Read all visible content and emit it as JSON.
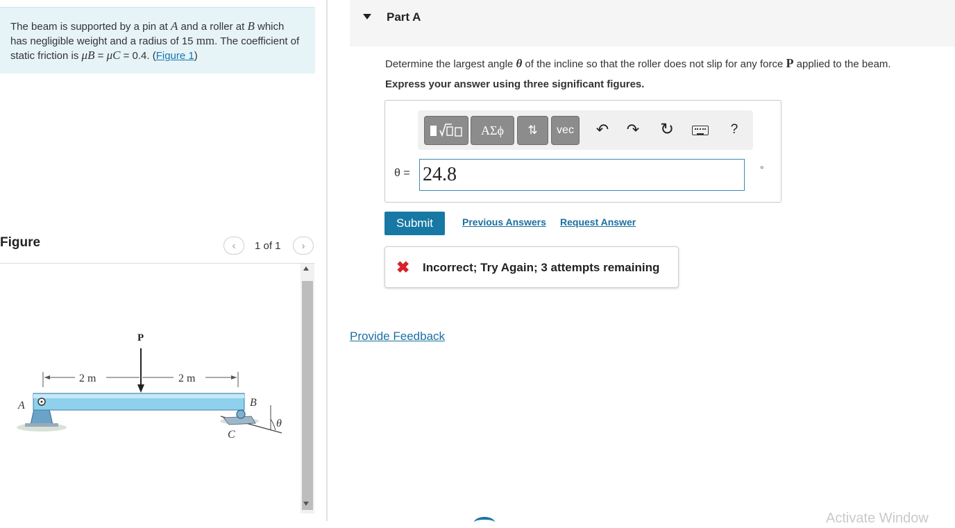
{
  "problem": {
    "text_1": "The beam is supported by a pin at ",
    "point_a": "A",
    "text_2": " and a roller at ",
    "point_b": "B",
    "text_3": " which has negligible weight and a radius of 15 ",
    "unit_mm": "mm",
    "text_4": ". The coefficient of static friction is ",
    "mu_b": "μB",
    "text_5": " = ",
    "mu_c": "μC",
    "text_6": " = 0.4. (",
    "figure_link": "Figure 1",
    "text_7": ")"
  },
  "figure": {
    "label": "Figure",
    "counter": "1 of 1",
    "prev_icon": "chevron-left",
    "next_icon": "chevron-right",
    "labels": {
      "p": "P",
      "a": "A",
      "b": "B",
      "c": "C",
      "theta": "θ",
      "dim_left": "2 m",
      "dim_right": "2 m"
    }
  },
  "part": {
    "toggle_icon": "caret-down",
    "title": "Part A",
    "question_1": "Determine the largest angle ",
    "question_theta": "θ",
    "question_2": " of the incline so that the roller does not slip for any force ",
    "question_p": "P",
    "question_3": " applied to the beam.",
    "instruction": "Express your answer using three significant figures."
  },
  "toolbar": {
    "buttons": [
      "ΑΣϕ",
      "vec"
    ],
    "icons": [
      "templates-icon",
      "subscript-icon",
      "undo-icon",
      "redo-icon",
      "reset-icon",
      "keyboard-icon",
      "help-icon"
    ],
    "help": "?"
  },
  "answer": {
    "variable": "θ =",
    "value": "24.8",
    "unit": "°"
  },
  "actions": {
    "submit": "Submit",
    "previous_answers": "Previous Answers",
    "request_answer": "Request Answer"
  },
  "feedback": {
    "icon": "x-icon",
    "message": "Incorrect; Try Again; 3 attempts remaining"
  },
  "footer": {
    "provide_feedback": "Provide Feedback",
    "watermark": "Activate Window"
  },
  "colors": {
    "problem_bg": "#e6f4f8",
    "accent": "#1778a4",
    "error": "#d8222b",
    "beam": "#8fd0ec"
  }
}
